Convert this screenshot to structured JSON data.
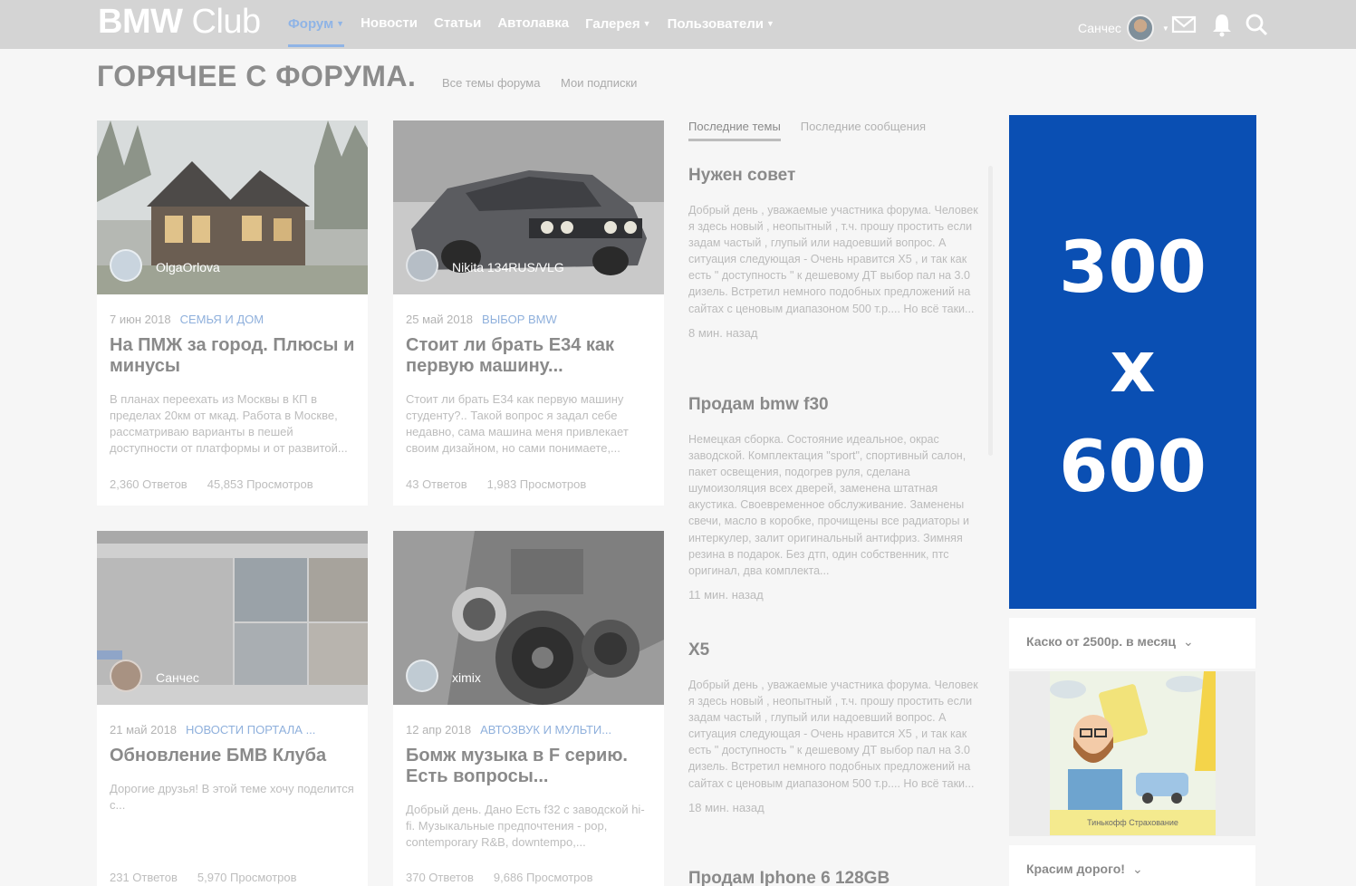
{
  "header": {
    "logo_bold": "BMW",
    "logo_rest": " Club",
    "nav": [
      {
        "label": "Форум",
        "active": true,
        "dropdown": true
      },
      {
        "label": "Новости",
        "active": false,
        "dropdown": false
      },
      {
        "label": "Статьи",
        "active": false,
        "dropdown": false
      },
      {
        "label": "Автолавка",
        "active": false,
        "dropdown": false
      },
      {
        "label": "Галерея",
        "active": false,
        "dropdown": true
      },
      {
        "label": "Пользователи",
        "active": false,
        "dropdown": true
      }
    ],
    "username": "Санчес",
    "icons": [
      "mail-icon",
      "bell-icon",
      "search-icon"
    ]
  },
  "page": {
    "title": "ГОРЯЧЕЕ С ФОРУМА.",
    "subnav": [
      "Все темы форума",
      "Мои подписки"
    ]
  },
  "cards": [
    {
      "author": "OlgaOrlova",
      "date": "7 июн 2018",
      "category": "СЕМЬЯ И ДОМ",
      "title": "На ПМЖ за город. Плюсы и минусы",
      "excerpt": "В планах переехать из Москвы в КП в пределах 20км от мкад. Работа в Москве, рассматриваю варианты в пешей доступности от платформы и от развитой...",
      "replies": "2,360 Ответов",
      "views": "45,853 Просмотров",
      "image": "house-photo"
    },
    {
      "author": "Nikita 134RUS/VLG",
      "date": "25 май 2018",
      "category": "ВЫБОР BMW",
      "title": "Стоит ли брать Е34 как первую машину...",
      "excerpt": "Стоит ли брать Е34 как первую машину студенту?.. Такой вопрос я задал себе недавно, сама машина меня привлекает своим дизайном, но сами понимаете,...",
      "replies": "43 Ответов",
      "views": "1,983 Просмотров",
      "image": "bmw-e34-photo"
    },
    {
      "author": "Санчес",
      "date": "21 май 2018",
      "category": "НОВОСТИ ПОРТАЛА ...",
      "title": "Обновление БМВ Клуба",
      "excerpt": "Дорогие друзья! В этой теме хочу поделится с...",
      "replies": "231 Ответов",
      "views": "5,970 Просмотров",
      "image": "site-screenshot"
    },
    {
      "author": "ximix",
      "date": "12 апр 2018",
      "category": "АВТОЗВУК И МУЛЬТИ...",
      "title": "Бомж музыка в F серию. Есть вопросы...",
      "excerpt": "Добрый день. Дано Есть f32 с заводской hi-fi. Музыкальные предпочтения - pop, contemporary R&B, downtempo,...",
      "replies": "370 Ответов",
      "views": "9,686 Просмотров",
      "image": "speakers-photo"
    }
  ],
  "latest": {
    "tabs": [
      "Последние темы",
      "Последние сообщения"
    ],
    "topics": [
      {
        "title": "Нужен совет",
        "excerpt": "Добрый день , уважаемые участника форума. Человек я здесь новый , неопытный , т.ч. прошу простить если задам частый , глупый или надоевший вопрос. А ситуация следующая - Очень нравится X5 , и так как есть \" доступность \" к дешевому ДТ выбор пал на 3.0 дизель. Встретил немного подобных предложений на сайтах с ценовым диапазоном 500 т.р.... Но всё таки...",
        "ago": "8 мин. назад"
      },
      {
        "title": "Продам bmw f30",
        "excerpt": "Немецкая сборка. Состояние идеальное, окрас заводской. Комплектация \"sport\", спортивный салон, пакет освещения, подогрев руля, сделана шумоизоляция всех дверей, заменена штатная акустика. Своевременное обслуживание. Заменены свечи, масло в коробке, прочищены все радиаторы и интеркулер, залит оригинальный антифриз. Зимняя резина в подарок. Без дтп, один собственник, птс оригинал, два комплекта...",
        "ago": "11 мин. назад"
      },
      {
        "title": "X5",
        "excerpt": "Добрый день , уважаемые участника форума. Человек я здесь новый , неопытный , т.ч. прошу простить если задам частый , глупый или надоевший вопрос. А ситуация следующая - Очень нравится X5 , и так как есть \" доступность \" к дешевому ДТ выбор пал на 3.0 дизель. Встретил немного подобных предложений на сайтах с ценовым диапазоном 500 т.р.... Но всё таки...",
        "ago": "18 мин. назад"
      },
      {
        "title": "Продам Iphone 6 128GB",
        "excerpt": "",
        "ago": ""
      }
    ]
  },
  "sidebar": {
    "ad_lines": [
      "300",
      "x",
      "600"
    ],
    "widget1": "Каско от 2500р. в месяц",
    "widget1_ad_brand": "Тинькофф Страхование",
    "widget2": "Красим дорого!"
  },
  "colors": {
    "header_bg": "#d4d4d4",
    "accent": "#8fb4e6",
    "ad_blue": "#0a4fb3",
    "page_bg": "#f6f6f6"
  }
}
